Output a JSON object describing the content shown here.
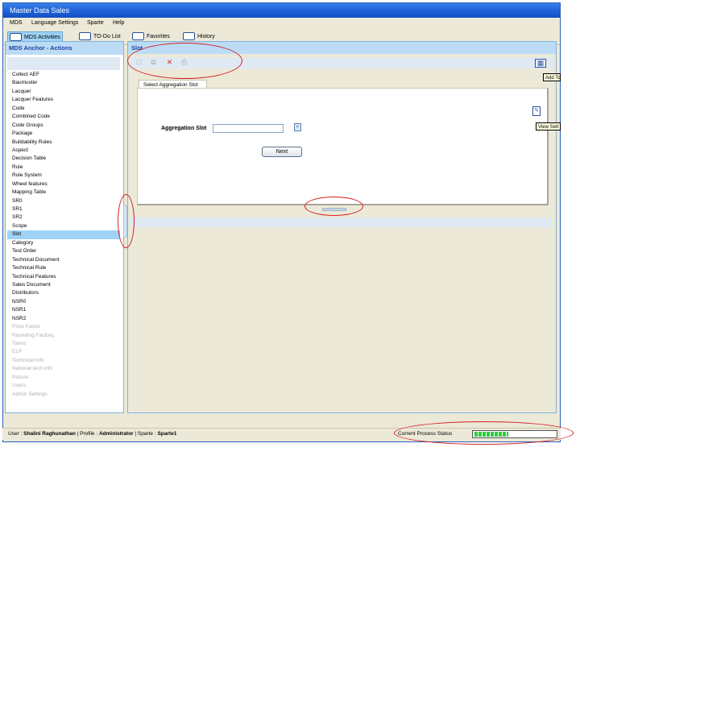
{
  "window": {
    "title": "Master Data Sales"
  },
  "menu": [
    "MDS",
    "Language Settings",
    "Sparte",
    "Help"
  ],
  "tabs": [
    {
      "label": "MDS Activities",
      "active": true
    },
    {
      "label": "TO-Do List",
      "active": false
    },
    {
      "label": "Favorites",
      "active": false
    },
    {
      "label": "History",
      "active": false
    }
  ],
  "left_panel": {
    "title": "MDS Anchor - Actions",
    "items": [
      {
        "label": "Collect AEF"
      },
      {
        "label": "Baumuster"
      },
      {
        "label": "Lacquer"
      },
      {
        "label": "Lacquer Features"
      },
      {
        "label": "Code"
      },
      {
        "label": "Combined Code"
      },
      {
        "label": "Code Groups"
      },
      {
        "label": "Package"
      },
      {
        "label": "Buildability Rules"
      },
      {
        "label": "Aspect"
      },
      {
        "label": "Decision Table"
      },
      {
        "label": "Rule"
      },
      {
        "label": "Rule System"
      },
      {
        "label": "Wheel features"
      },
      {
        "label": "Mapping Table"
      },
      {
        "label": "SR0"
      },
      {
        "label": "SR1"
      },
      {
        "label": "SR2"
      },
      {
        "label": "Scope"
      },
      {
        "label": "Slot",
        "selected": true
      },
      {
        "label": "Category"
      },
      {
        "label": "Test Order"
      },
      {
        "label": "Technical Document"
      },
      {
        "label": "Technical Rule"
      },
      {
        "label": "Technical Features"
      },
      {
        "label": "Sales Document"
      },
      {
        "label": "Distributors"
      },
      {
        "label": "NSR0"
      },
      {
        "label": "NSR1"
      },
      {
        "label": "NSR2"
      },
      {
        "label": "Price Factor",
        "disabled": true
      },
      {
        "label": "Rounding Factorq",
        "disabled": true
      },
      {
        "label": "Taxes",
        "disabled": true
      },
      {
        "label": "ELP",
        "disabled": true
      },
      {
        "label": "Technical Info",
        "disabled": true
      },
      {
        "label": "National tech info",
        "disabled": true
      },
      {
        "label": "Picture",
        "disabled": true
      },
      {
        "label": "Users",
        "disabled": true
      },
      {
        "label": "Admin Settings",
        "disabled": true
      }
    ]
  },
  "main": {
    "title": "Slot",
    "toolbar_icons": [
      "new-document-icon",
      "copy-icon",
      "delete-icon",
      "print-icon"
    ],
    "inner_tab": "Select Aggregation Slot",
    "form": {
      "aggregation_slot_label": "Aggregation Slot",
      "aggregation_slot_value": "",
      "next_label": "Next"
    }
  },
  "tooltips": {
    "add": "Add To",
    "view": "View Sett"
  },
  "status": {
    "user_prefix": "User : ",
    "user": "Shalini Raghunathan",
    "profile_prefix": " | Profile : ",
    "profile": "Administrator",
    "sparte_prefix": " | Sparte : ",
    "sparte": "Sparte1",
    "process_label": "Current Process Status",
    "progress": 0.42
  },
  "colors": {
    "title_bar": "#1b5fd6",
    "selection": "#9fd3f5",
    "annotation": "#d42020",
    "progress": "#2ecc40"
  }
}
